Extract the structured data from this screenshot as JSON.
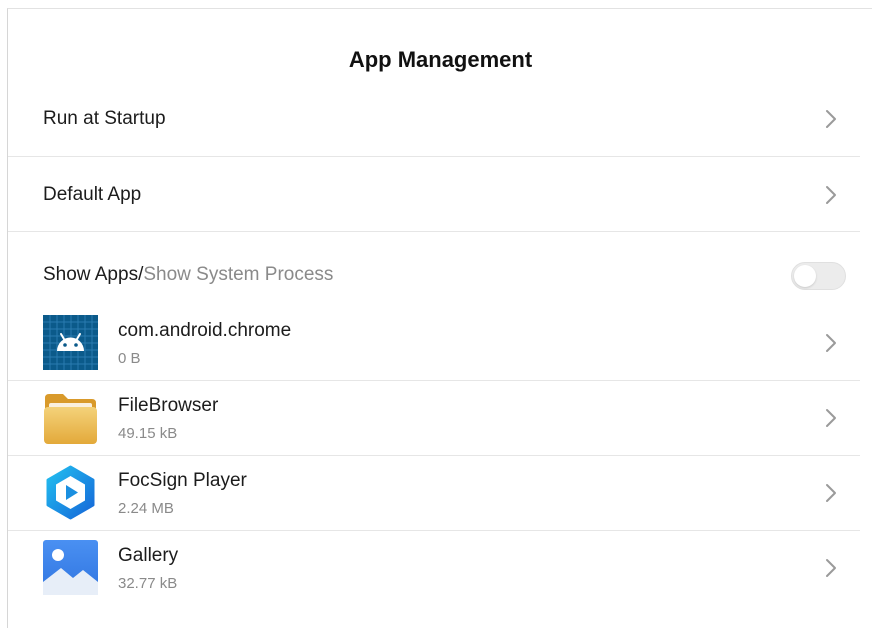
{
  "header": {
    "title": "App Management"
  },
  "menu": {
    "run_at_startup": "Run at Startup",
    "default_app": "Default App"
  },
  "show_toggle": {
    "show_apps": "Show Apps",
    "separator": "/",
    "show_system_process": "Show System Process",
    "enabled": false
  },
  "apps": [
    {
      "name": "com.android.chrome",
      "size": "0 B",
      "icon": "android-icon"
    },
    {
      "name": "FileBrowser",
      "size": "49.15 kB",
      "icon": "folder-icon"
    },
    {
      "name": "FocSign Player",
      "size": "2.24 MB",
      "icon": "play-icon"
    },
    {
      "name": "Gallery",
      "size": "32.77 kB",
      "icon": "gallery-icon"
    }
  ],
  "colors": {
    "android_bg": "#0b5a8a",
    "folder": "#e9b84a",
    "player": "#1a8fe0",
    "gallery": "#3d8ef0",
    "secondary_text": "#8a8a8a"
  }
}
